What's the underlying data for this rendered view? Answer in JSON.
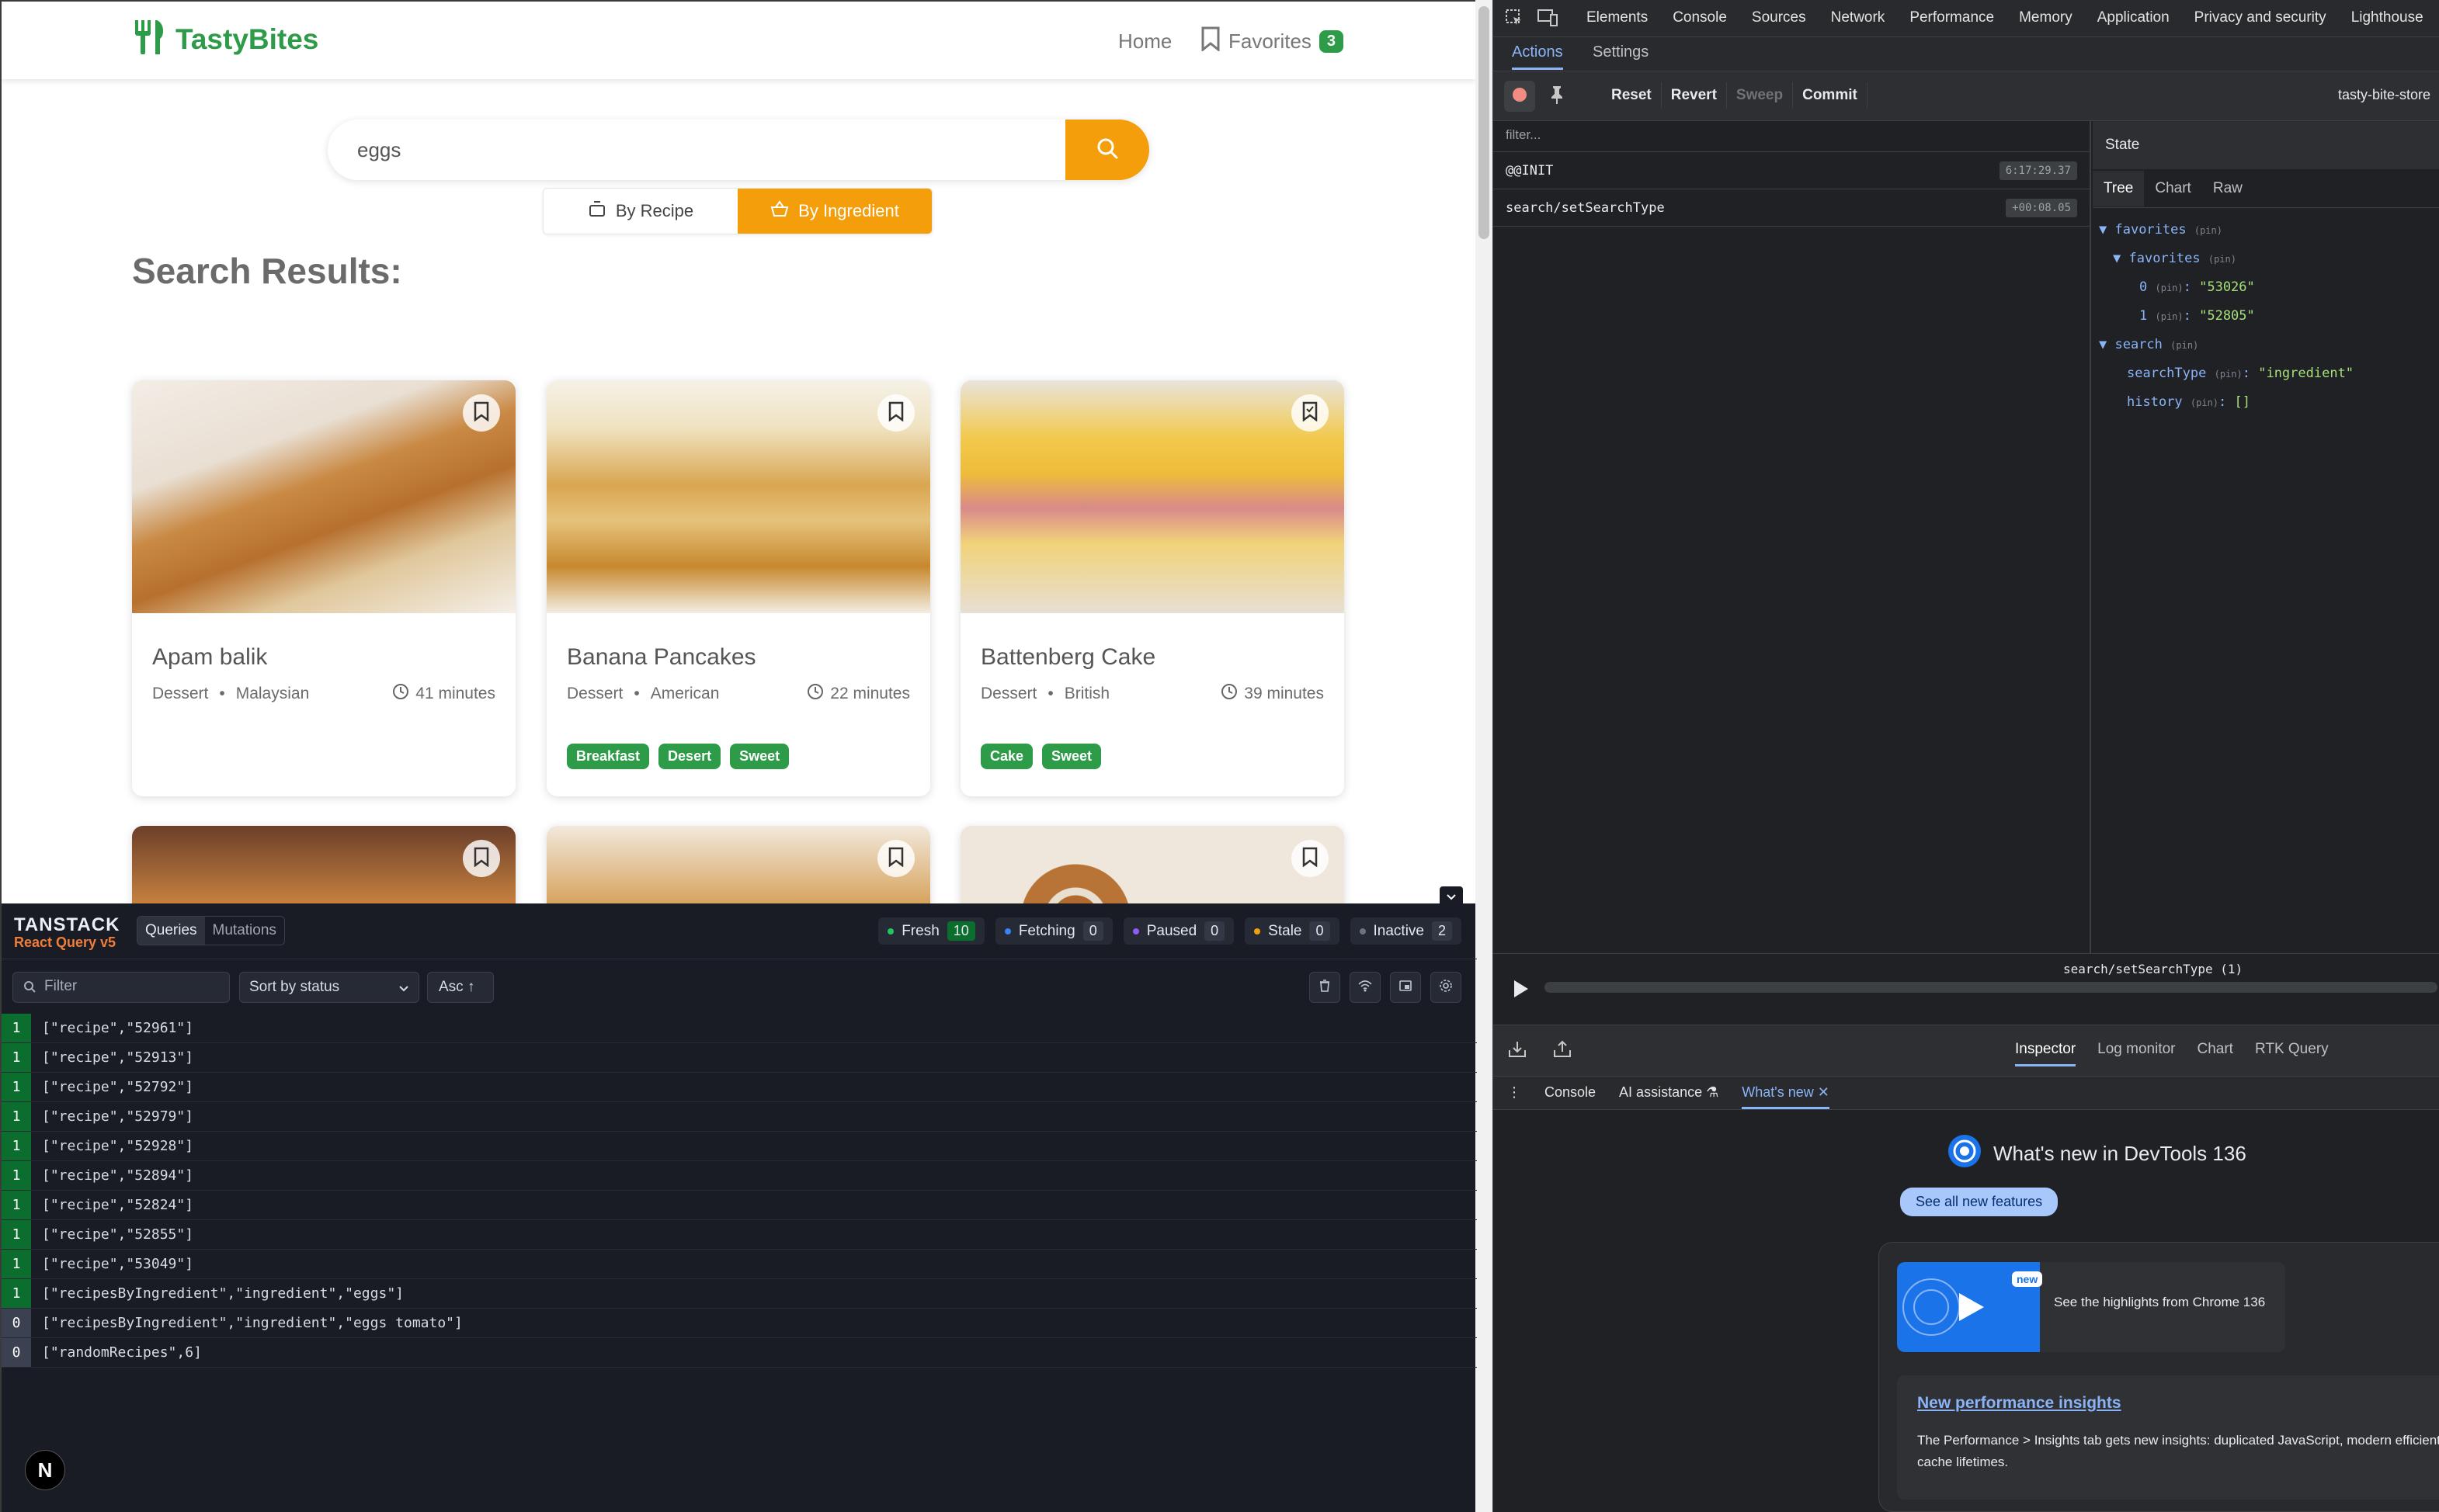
{
  "app": {
    "logo_text": "TastyBites",
    "nav_home": "Home",
    "nav_favorites": "Favorites",
    "favorites_count": "3",
    "search_value": "eggs",
    "toggle_by_recipe": "By Recipe",
    "toggle_by_ingredient": "By Ingredient",
    "results_title": "Search Results:",
    "cards": [
      {
        "title": "Apam balik",
        "category": "Dessert",
        "area": "Malaysian",
        "time": "41 minutes",
        "tags": []
      },
      {
        "title": "Banana Pancakes",
        "category": "Dessert",
        "area": "American",
        "time": "22 minutes",
        "tags": [
          "Breakfast",
          "Desert",
          "Sweet"
        ]
      },
      {
        "title": "Battenberg Cake",
        "category": "Dessert",
        "area": "British",
        "time": "39 minutes",
        "tags": [
          "Cake",
          "Sweet"
        ]
      }
    ],
    "meta_separator": "•"
  },
  "tanstack": {
    "brand_top": "TANSTACK",
    "brand_bottom": "React Query v5",
    "tab_queries": "Queries",
    "tab_mutations": "Mutations",
    "stats": [
      {
        "label": "Fresh",
        "count": "10",
        "color": "#22c55e"
      },
      {
        "label": "Fetching",
        "count": "0",
        "color": "#3b82f6"
      },
      {
        "label": "Paused",
        "count": "0",
        "color": "#8b5cf6"
      },
      {
        "label": "Stale",
        "count": "0",
        "color": "#f59e0b"
      },
      {
        "label": "Inactive",
        "count": "2",
        "color": "#6b7280"
      }
    ],
    "filter_placeholder": "Filter",
    "sort_label": "Sort by status",
    "asc_label": "Asc ↑",
    "queries": [
      {
        "count": "1",
        "key": "[\"recipe\",\"52961\"]"
      },
      {
        "count": "1",
        "key": "[\"recipe\",\"52913\"]"
      },
      {
        "count": "1",
        "key": "[\"recipe\",\"52792\"]"
      },
      {
        "count": "1",
        "key": "[\"recipe\",\"52979\"]"
      },
      {
        "count": "1",
        "key": "[\"recipe\",\"52928\"]"
      },
      {
        "count": "1",
        "key": "[\"recipe\",\"52894\"]"
      },
      {
        "count": "1",
        "key": "[\"recipe\",\"52824\"]"
      },
      {
        "count": "1",
        "key": "[\"recipe\",\"52855\"]"
      },
      {
        "count": "1",
        "key": "[\"recipe\",\"53049\"]"
      },
      {
        "count": "1",
        "key": "[\"recipesByIngredient\",\"ingredient\",\"eggs\"]"
      },
      {
        "count": "0",
        "key": "[\"recipesByIngredient\",\"ingredient\",\"eggs tomato\"]"
      },
      {
        "count": "0",
        "key": "[\"randomRecipes\",6]"
      }
    ],
    "next_badge": "N"
  },
  "devtools": {
    "tabs": [
      "Elements",
      "Console",
      "Sources",
      "Network",
      "Performance",
      "Memory",
      "Application",
      "Privacy and security",
      "Lighthouse"
    ],
    "sub_actions": "Actions",
    "sub_settings": "Settings",
    "buttons": [
      "Reset",
      "Revert",
      "Sweep",
      "Commit"
    ],
    "store_name": "tasty-bite-store",
    "filter_placeholder": "filter...",
    "actions": [
      {
        "name": "@@INIT",
        "time": "6:17:29.37"
      },
      {
        "name": "search/setSearchType",
        "time": "+00:08.05"
      }
    ],
    "state_title": "State",
    "state_tabs": [
      "Tree",
      "Chart",
      "Raw"
    ],
    "tree": {
      "favorites_key": "favorites",
      "favorites_inner_key": "favorites",
      "pin": "(pin)",
      "fav0_index": "0",
      "fav0_value": "\"53026\"",
      "fav1_index": "1",
      "fav1_value": "\"52805\"",
      "search_key": "search",
      "searchType_key": "searchType",
      "searchType_value": "\"ingredient\"",
      "history_key": "history",
      "history_value": "[]"
    },
    "slider_label": "search/setSearchType (1)",
    "bottom_tabs": [
      "Inspector",
      "Log monitor",
      "Chart",
      "RTK Query"
    ],
    "drawer_tabs": {
      "console": "Console",
      "ai": "AI assistance",
      "whats_new": "What's new"
    },
    "whats_new": {
      "title": "What's new in DevTools 136",
      "button": "See all new features",
      "highlight_text": "See the highlights from Chrome 136",
      "new_badge": "new",
      "insights_title": "New performance insights",
      "insights_text": "The Performance > Insights tab gets new insights: duplicated JavaScript, modern efficient cache lifetimes."
    }
  }
}
